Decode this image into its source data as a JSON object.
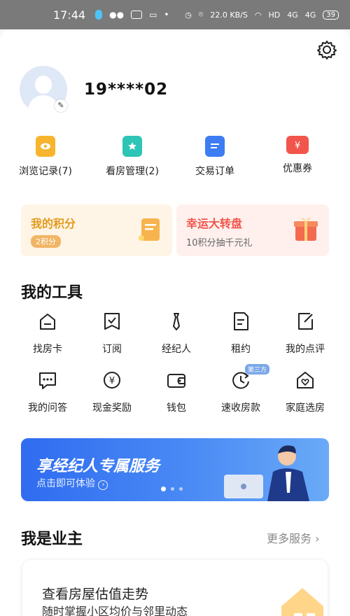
{
  "status_bar": {
    "time": "17:44",
    "net_speed": "22.0 KB/S",
    "hd": "HD",
    "signal1": "4G",
    "signal2": "4G",
    "battery": "39"
  },
  "profile": {
    "username": "19****02"
  },
  "quick_actions": [
    {
      "label": "浏览记录(7)",
      "icon": "eye-icon",
      "color": "#f6b52d"
    },
    {
      "label": "看房管理(2)",
      "icon": "folder-star-icon",
      "color": "#2ec4b6"
    },
    {
      "label": "交易订单",
      "icon": "document-icon",
      "color": "#3d7cf2"
    },
    {
      "label": "优惠券",
      "icon": "coupon-icon",
      "color": "#f2554b"
    }
  ],
  "promos": {
    "points": {
      "title": "我的积分",
      "badge": "2积分"
    },
    "lottery": {
      "title": "幸运大转盘",
      "subtitle": "10积分抽千元礼"
    }
  },
  "tools_section": {
    "title": "我的工具",
    "items": [
      {
        "label": "找房卡",
        "icon": "house-card-icon"
      },
      {
        "label": "订阅",
        "icon": "subscribe-icon"
      },
      {
        "label": "经纪人",
        "icon": "tie-icon"
      },
      {
        "label": "租约",
        "icon": "lease-icon"
      },
      {
        "label": "我的点评",
        "icon": "review-edit-icon"
      },
      {
        "label": "我的问答",
        "icon": "chat-bubble-icon"
      },
      {
        "label": "现金奖励",
        "icon": "yen-circle-icon"
      },
      {
        "label": "钱包",
        "icon": "wallet-icon"
      },
      {
        "label": "速收房款",
        "icon": "clock-arrow-icon",
        "tag": "第三方"
      },
      {
        "label": "家庭选房",
        "icon": "home-heart-icon"
      }
    ]
  },
  "banner": {
    "title": "享经纪人专属服务",
    "subtitle": "点击即可体验"
  },
  "owner_section": {
    "title": "我是业主",
    "more": "更多服务",
    "card_title": "查看房屋估值走势",
    "card_subtitle": "随时掌握小区均价与邻里动态"
  },
  "colors": {
    "accent_blue": "#3d7cf2",
    "orange": "#e39a1c",
    "red": "#f0554a"
  }
}
